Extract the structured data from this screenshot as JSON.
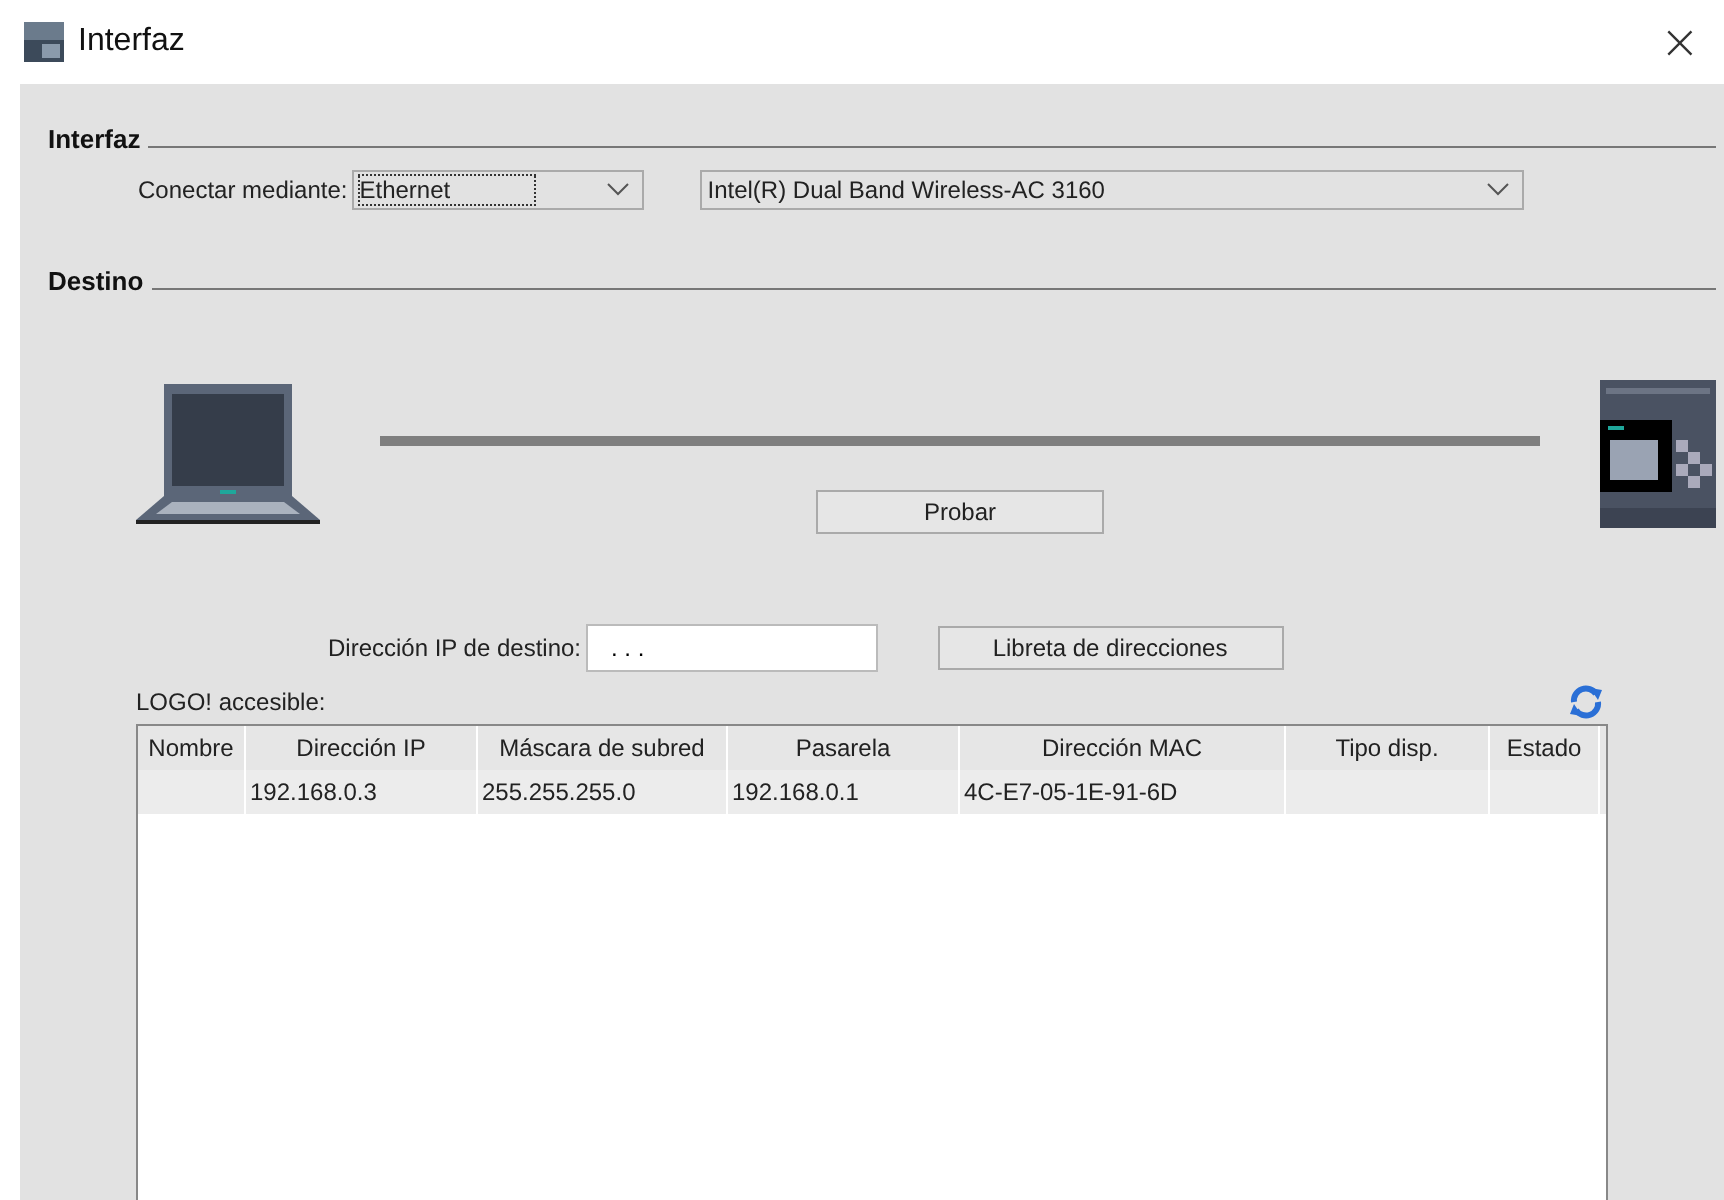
{
  "window": {
    "title": "Interfaz",
    "close": "×"
  },
  "interface_section": {
    "title": "Interfaz",
    "connect_label": "Conectar mediante:",
    "connect_value": "Ethernet",
    "adapter_value": "Intel(R) Dual Band Wireless-AC 3160"
  },
  "target_section": {
    "title": "Destino",
    "test_button": "Probar",
    "ip_label": "Dirección IP de destino:",
    "ip_value": ". . .",
    "address_book_button": "Libreta de direcciones",
    "accessible_label": "LOGO! accesible:"
  },
  "table": {
    "columns": [
      "Nombre",
      "Dirección IP",
      "Máscara de subred",
      "Pasarela",
      "Dirección MAC",
      "Tipo disp.",
      "Estado"
    ],
    "rows": [
      {
        "cells": [
          "",
          "192.168.0.3",
          "255.255.255.0",
          "192.168.0.1",
          "4C-E7-05-1E-91-6D",
          "",
          ""
        ],
        "selected": false
      }
    ]
  }
}
